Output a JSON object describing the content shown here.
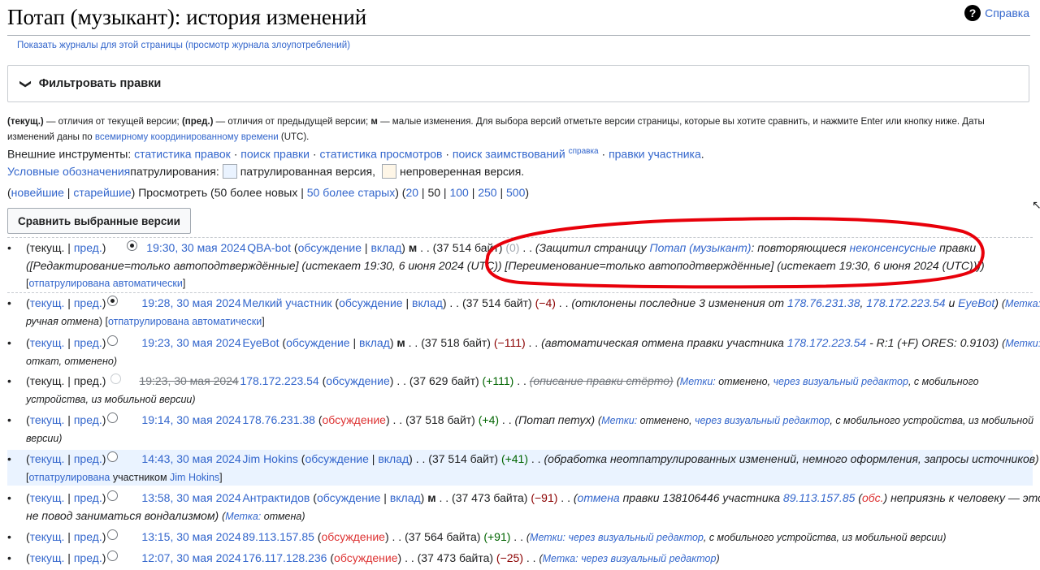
{
  "page": {
    "title": "Потап (музыкант): история изменений",
    "help": "Справка",
    "logs_link": "Показать журналы для этой страницы",
    "abuse_link": "(просмотр журнала злоупотреблений)",
    "filter_label": "Фильтровать правки"
  },
  "legend": {
    "cur_abbr": "(текущ.)",
    "cur_desc": " — отличия от текущей версии; ",
    "prev_abbr": "(пред.)",
    "prev_desc": " — отличия от предыдущей версии; ",
    "minor_abbr": "м",
    "minor_desc": " — малые изменения. Для выбора версий отметьте версии страницы, которые вы хотите сравнить, и нажмите Enter или кнопку ниже. Даты изменений даны по ",
    "utc_link": "всемирному координированному времени",
    "utc_tail": " (UTC)."
  },
  "tools": {
    "label": "Внешние инструменты: ",
    "items": [
      "статистика правок",
      "поиск правки",
      "статистика просмотров",
      "поиск заимствований"
    ],
    "sup": "справка",
    "last": "правки участника",
    "sep": " · "
  },
  "patrol": {
    "link": "Условные обозначения",
    "label": " патрулирования: ",
    "patrolled": "патрулированная версия,",
    "unchecked": "непроверенная версия."
  },
  "nav": {
    "newest": "новейшие",
    "oldest": "старейшие",
    "view": "Просмотреть",
    "newer": "(50 более новых",
    "older": "50 более старых",
    "limits": [
      "20",
      "50",
      "100",
      "250",
      "500"
    ]
  },
  "compare_button": "Сравнить выбранные версии",
  "common": {
    "cur": "текущ.",
    "prev": "пред.",
    "talk": "обсуждение",
    "contrib": "вклад",
    "minor": "м"
  },
  "revisions": [
    {
      "date": "19:30, 30 мая 2024",
      "user": "QBA-bot",
      "size": "(37 514 байт)",
      "diff": "(0)",
      "comment_a": "(Защитил страницу ",
      "comment_link1": "Потап (музыкант)",
      "comment_b": ": повторяющиеся ",
      "comment_link2": "неконсенсусные",
      "comment_c": " правки",
      "line2": "([Редактирование=только автоподтверждённые] (истекает 19:30, 6 июня 2024 (UTC)) [Переименование=только автоподтверждённые] (истекает 19:30, 6 июня 2024 (UTC))))",
      "line3": "отпатрулирована автоматически"
    },
    {
      "date": "19:28, 30 мая 2024",
      "user": "Мелкий участник",
      "size": "(37 514 байт)",
      "diff": "(−4)",
      "comment_a": "(отклонены последние 3 изменения от ",
      "ip1": "178.76.231.38",
      "ip2": "178.172.223.54",
      "and": " и ",
      "bot": "EyeBot",
      "tag_label": "Метка:",
      "tag_value": "ручная отмена",
      "patrol": "отпатрулирована автоматически"
    },
    {
      "date": "19:23, 30 мая 2024",
      "user": "EyeBot",
      "size": "(37 518 байт)",
      "diff": "(−111)",
      "comment_a": "(автоматическая отмена правки участника ",
      "ip": "178.172.223.54",
      "comment_b": " - R:1 (+F) ORES: 0.9103)",
      "tag_label": "Метки:",
      "tag_value": "откат, отменено)"
    },
    {
      "date": "19:23, 30 мая 2024",
      "user": "178.172.223.54",
      "size": "(37 629 байт)",
      "diff": "(+111)",
      "comment": "(описание правки стёрто)",
      "tag_label": "Метки:",
      "tag_a": " отменено, ",
      "tag_link": "через визуальный редактор",
      "tag_b": ", с мобильного",
      "line2": "устройства, из мобильной версии)"
    },
    {
      "date": "19:14, 30 мая 2024",
      "user": "178.76.231.38",
      "size": "(37 518 байт)",
      "diff": "(+4)",
      "comment": "(Потап петух)",
      "tag_label": "Метки:",
      "tag_a": " отменено, ",
      "tag_link": "через визуальный редактор",
      "tag_b": ", с мобильного устройства, из мобильной",
      "line2": "версии)"
    },
    {
      "date": "14:43, 30 мая 2024",
      "user": "Jim Hokins",
      "size": "(37 514 байт)",
      "diff": "(+41)",
      "comment": "(обработка неотпатрулированных изменений, немного оформления, запросы источников)",
      "patrol_link": "отпатрулирована",
      "patrol_by": " участником ",
      "patrol_user": "Jim Hokins"
    },
    {
      "date": "13:58, 30 мая 2024",
      "user": "Антрактидов",
      "size": "(37 473 байта)",
      "diff": "(−91)",
      "undo": "отмена",
      "comment_a": " правки 138106446 участника ",
      "ip": "89.113.157.85",
      "obs": "обс.",
      "comment_b": ") неприязнь к человеку — это",
      "line2": "не повод заниматься вондализмом)",
      "tag_label": "Метка:",
      "tag_value": " отмена)"
    },
    {
      "date": "13:15, 30 мая 2024",
      "user": "89.113.157.85",
      "size": "(37 564 байта)",
      "diff": "(+91)",
      "tag_label": "Метки:",
      "tag_link": "через визуальный редактор",
      "tag_b": ", с мобильного устройства, из мобильной версии)"
    },
    {
      "date": "12:07, 30 мая 2024",
      "user": "176.117.128.236",
      "size": "(37 473 байта)",
      "diff": "(−25)",
      "tag_label": "Метка:",
      "tag_link": "через визуальный редактор"
    }
  ],
  "colors": {
    "link": "#3366cc",
    "red_link": "#d33",
    "positive": "#006400",
    "negative": "#8b0000",
    "unpatrolled_bg": "#eaf3ff",
    "annotation": "#e8000a"
  },
  "icons": [
    "help-icon",
    "chevron-icon",
    "radio-icon",
    "annotation-circle"
  ]
}
